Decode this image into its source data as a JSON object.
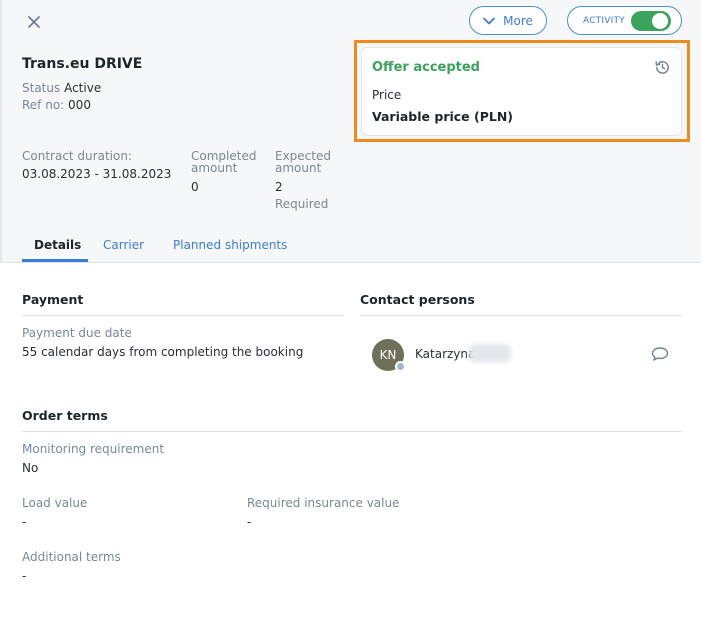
{
  "header": {
    "more_label": "More",
    "activity_label": "ACTIVITY",
    "activity_on": true
  },
  "contract": {
    "title": "Trans.eu DRIVE",
    "status_label": "Status",
    "status_value": "Active",
    "ref_label": "Ref no:",
    "ref_value": "000"
  },
  "offer": {
    "status": "Offer accepted",
    "price_label": "Price",
    "price_value": "Variable price (PLN)"
  },
  "stats": {
    "duration_label": "Contract duration:",
    "duration_value": "03.08.2023 - 31.08.2023",
    "completed_label_1": "Completed",
    "completed_label_2": "amount",
    "completed_value": "0",
    "expected_label_1": "Expected",
    "expected_label_2": "amount",
    "expected_value": "2",
    "expected_note": "Required"
  },
  "tabs": [
    {
      "label": "Details",
      "active": true
    },
    {
      "label": "Carrier",
      "active": false
    },
    {
      "label": "Planned shipments",
      "active": false
    }
  ],
  "payment": {
    "title": "Payment",
    "due_label": "Payment due date",
    "due_value": "55 calendar days from completing the booking"
  },
  "contacts": {
    "title": "Contact persons",
    "person": {
      "initials": "KN",
      "name": "Katarzyna"
    }
  },
  "order_terms": {
    "title": "Order terms",
    "monitoring_label": "Monitoring requirement",
    "monitoring_value": "No",
    "load_label": "Load value",
    "load_value": "-",
    "insurance_label": "Required insurance value",
    "insurance_value": "-",
    "additional_label": "Additional terms",
    "additional_value": "-"
  },
  "colors": {
    "accent": "#3b7dd8",
    "success": "#3aa35b",
    "highlight": "#f08a1c"
  }
}
